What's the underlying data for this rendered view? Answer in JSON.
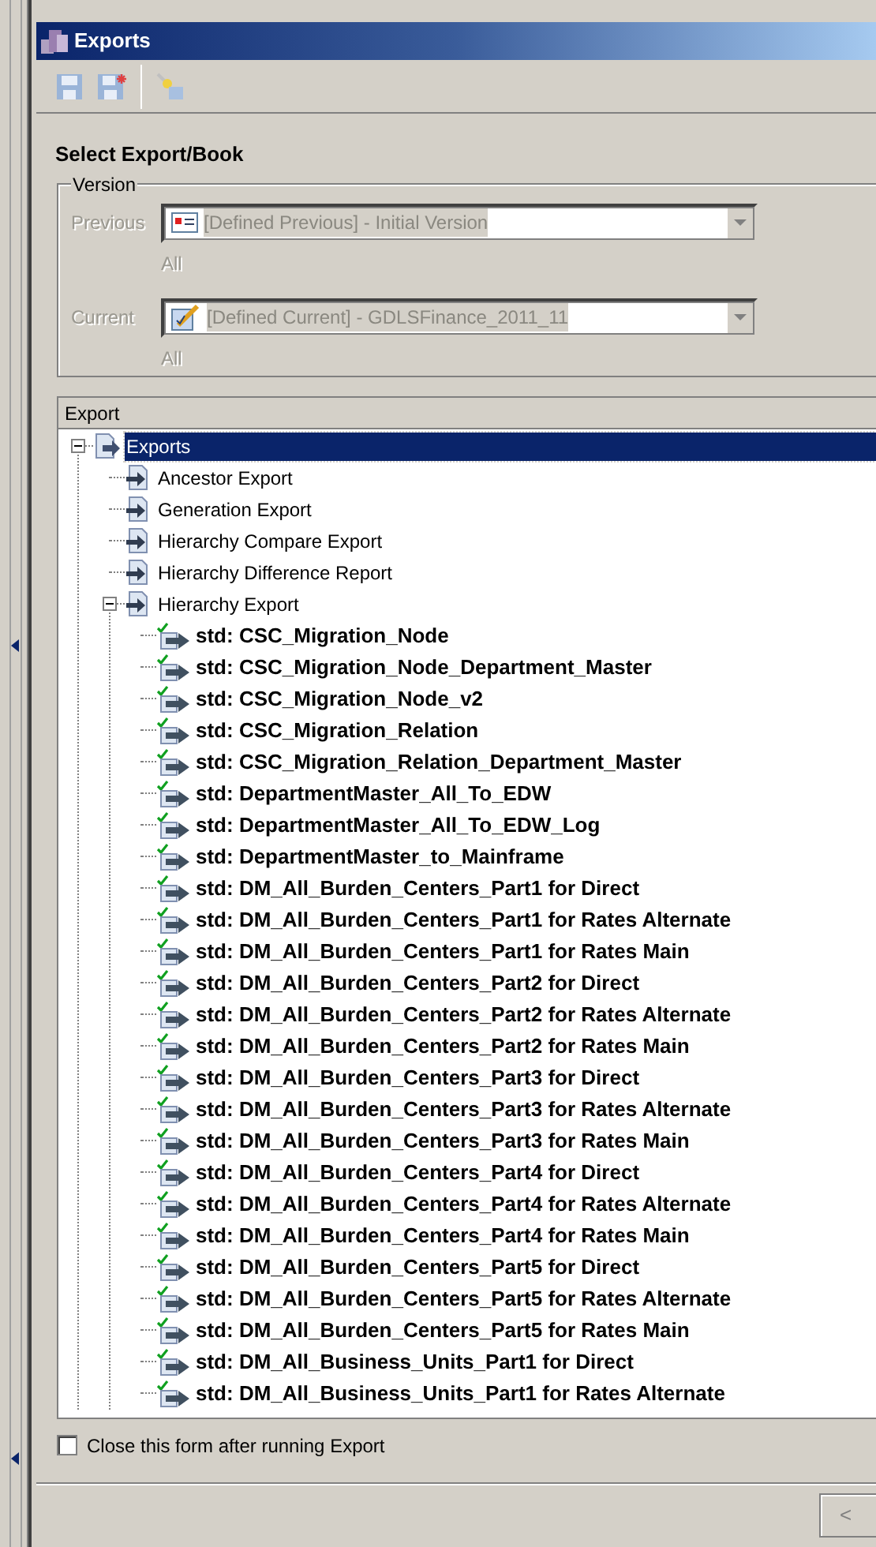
{
  "window": {
    "title": "Exports"
  },
  "heading": "Select Export/Book",
  "version_group": {
    "title": "Version",
    "disabled": true,
    "fields": [
      {
        "label": "Previous",
        "value": "[Defined Previous] - Initial Version",
        "kind": "previous",
        "note": "All"
      },
      {
        "label": "Current",
        "value": "[Defined Current] - GDLSFinance_2011_11",
        "kind": "current",
        "note": "All"
      }
    ]
  },
  "tree": {
    "header": "Export",
    "items": [
      {
        "label": "Exports",
        "kind": "folder",
        "selected": true,
        "expanded": true,
        "children": [
          {
            "label": "Ancestor Export",
            "kind": "type",
            "selected": false
          },
          {
            "label": "Generation Export",
            "kind": "type",
            "selected": false
          },
          {
            "label": "Hierarchy Compare Export",
            "kind": "type",
            "selected": false
          },
          {
            "label": "Hierarchy Difference Report",
            "kind": "type",
            "selected": false
          },
          {
            "label": "Hierarchy Export",
            "kind": "type",
            "selected": false,
            "expanded": true,
            "children": [
              {
                "label": "std: CSC_Migration_Node",
                "kind": "std",
                "selected": false
              },
              {
                "label": "std: CSC_Migration_Node_Department_Master",
                "kind": "std",
                "selected": false
              },
              {
                "label": "std: CSC_Migration_Node_v2",
                "kind": "std",
                "selected": false
              },
              {
                "label": "std: CSC_Migration_Relation",
                "kind": "std",
                "selected": false
              },
              {
                "label": "std: CSC_Migration_Relation_Department_Master",
                "kind": "std",
                "selected": false
              },
              {
                "label": "std: DepartmentMaster_All_To_EDW",
                "kind": "std",
                "selected": false
              },
              {
                "label": "std: DepartmentMaster_All_To_EDW_Log",
                "kind": "std",
                "selected": false
              },
              {
                "label": "std: DepartmentMaster_to_Mainframe",
                "kind": "std",
                "selected": false
              },
              {
                "label": "std: DM_All_Burden_Centers_Part1 for Direct",
                "kind": "std",
                "selected": false
              },
              {
                "label": "std: DM_All_Burden_Centers_Part1 for Rates Alternate",
                "kind": "std",
                "selected": false
              },
              {
                "label": "std: DM_All_Burden_Centers_Part1 for Rates Main",
                "kind": "std",
                "selected": false
              },
              {
                "label": "std: DM_All_Burden_Centers_Part2 for Direct",
                "kind": "std",
                "selected": false
              },
              {
                "label": "std: DM_All_Burden_Centers_Part2 for Rates Alternate",
                "kind": "std",
                "selected": false
              },
              {
                "label": "std: DM_All_Burden_Centers_Part2 for Rates Main",
                "kind": "std",
                "selected": false
              },
              {
                "label": "std: DM_All_Burden_Centers_Part3 for Direct",
                "kind": "std",
                "selected": false
              },
              {
                "label": "std: DM_All_Burden_Centers_Part3 for Rates Alternate",
                "kind": "std",
                "selected": false
              },
              {
                "label": "std: DM_All_Burden_Centers_Part3 for Rates Main",
                "kind": "std",
                "selected": false
              },
              {
                "label": "std: DM_All_Burden_Centers_Part4 for Direct",
                "kind": "std",
                "selected": false
              },
              {
                "label": "std: DM_All_Burden_Centers_Part4 for Rates Alternate",
                "kind": "std",
                "selected": false
              },
              {
                "label": "std: DM_All_Burden_Centers_Part4 for Rates Main",
                "kind": "std",
                "selected": false
              },
              {
                "label": "std: DM_All_Burden_Centers_Part5 for Direct",
                "kind": "std",
                "selected": false
              },
              {
                "label": "std: DM_All_Burden_Centers_Part5 for Rates Alternate",
                "kind": "std",
                "selected": false
              },
              {
                "label": "std: DM_All_Burden_Centers_Part5 for Rates Main",
                "kind": "std",
                "selected": false
              },
              {
                "label": "std: DM_All_Business_Units_Part1 for Direct",
                "kind": "std",
                "selected": false
              },
              {
                "label": "std: DM_All_Business_Units_Part1 for Rates Alternate",
                "kind": "std",
                "selected": false
              }
            ]
          }
        ]
      }
    ]
  },
  "close_option": {
    "label": "Close this form after running Export",
    "checked": false
  },
  "back_button": "<"
}
